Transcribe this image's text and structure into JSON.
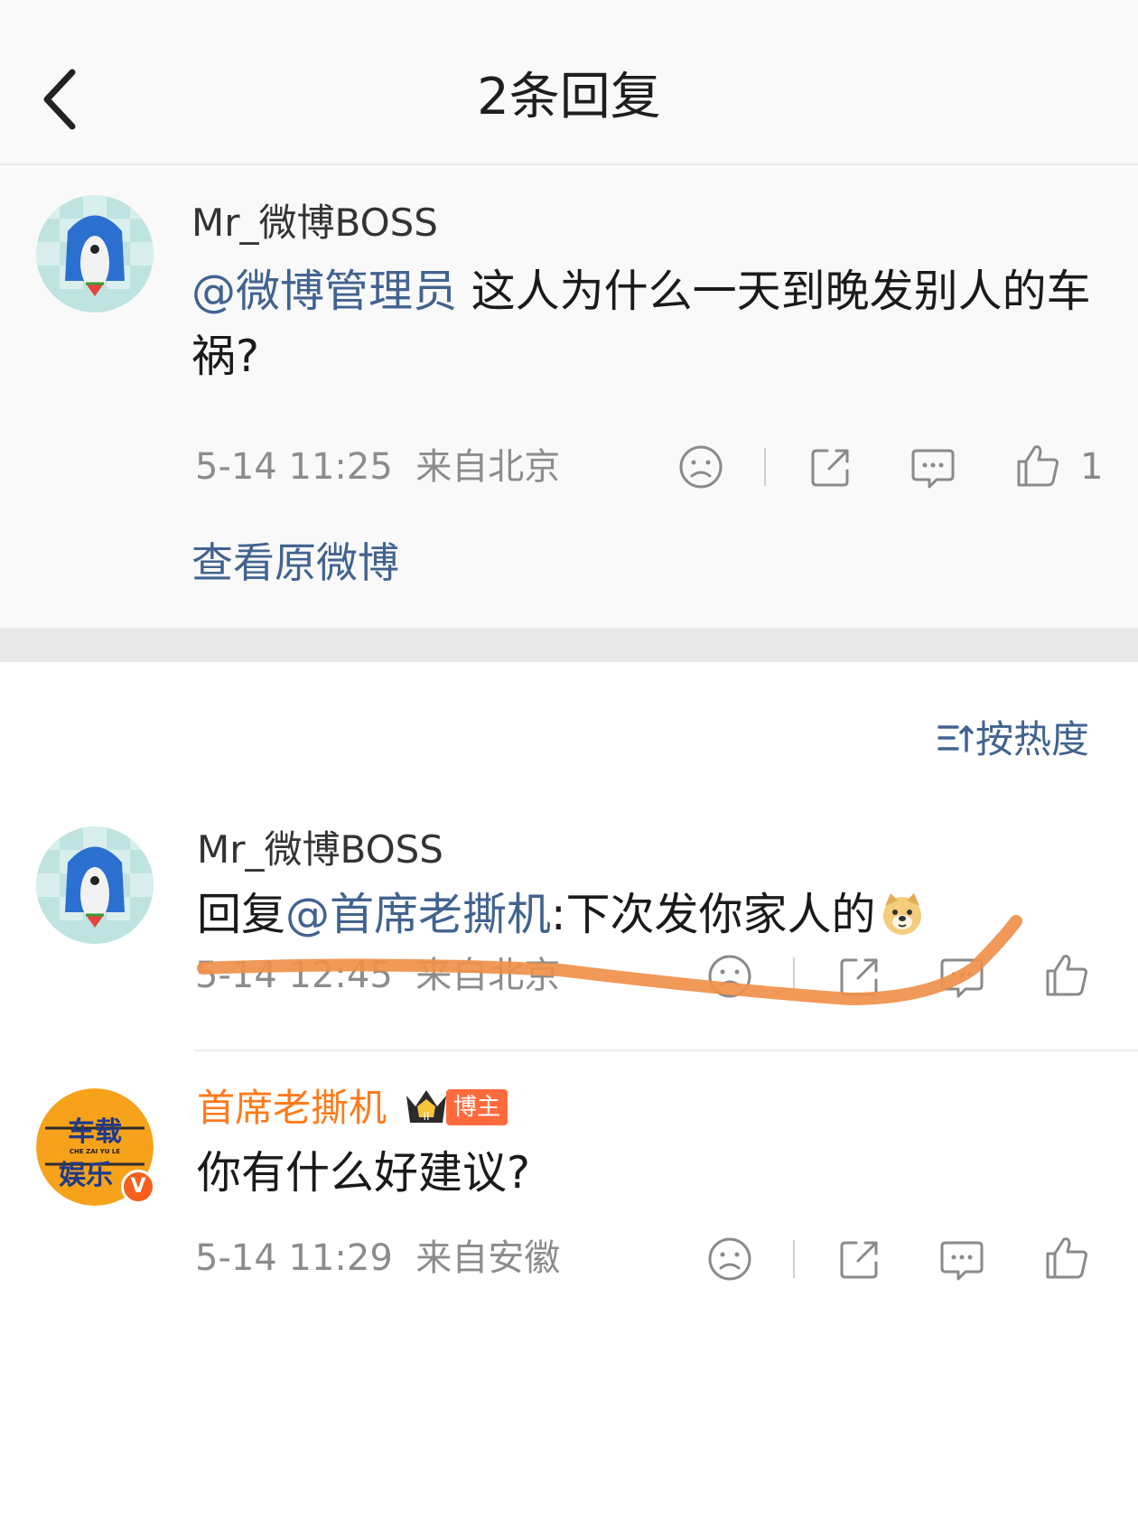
{
  "header": {
    "title": "2条回复",
    "back_icon": "chevron-left-icon"
  },
  "original_comment": {
    "username": "Mr_微博BOSS",
    "mention": "@微博管理员",
    "text": " 这人为什么一天到晚发别人的车祸?",
    "timestamp": "5-14 11:25",
    "location": "来自北京",
    "like_count": "1",
    "view_original": "查看原微博"
  },
  "sort": {
    "label": "按热度",
    "icon": "sort-icon"
  },
  "replies": [
    {
      "username": "Mr_微博BOSS",
      "prefix": "回复",
      "mention": "@首席老撕机",
      "text": ":下次发你家人的",
      "emoji": "doge-emoji",
      "timestamp": "5-14 12:45",
      "location": "来自北京"
    },
    {
      "username": "首席老撕机",
      "badge": "博主",
      "avatar_text": "车载",
      "avatar_subtext": "CHE ZAI YU LE",
      "avatar_text2": "娱乐",
      "verified": "V",
      "text": "你有什么好建议?",
      "timestamp": "5-14 11:29",
      "location": "来自安徽"
    }
  ],
  "colors": {
    "link": "#42638f",
    "orange_name": "#ff7a1a",
    "annotation": "#f0904a"
  }
}
